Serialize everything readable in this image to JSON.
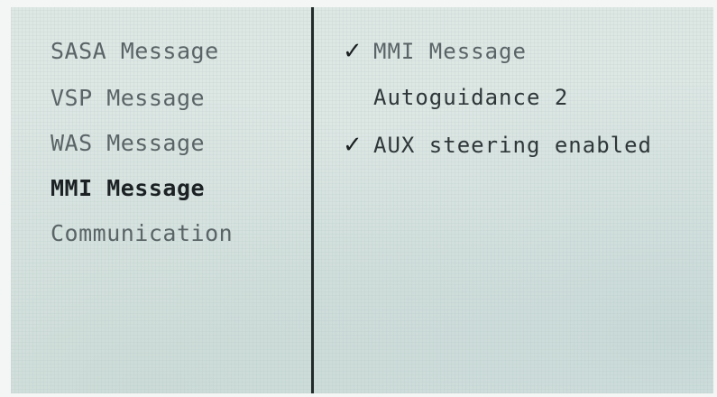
{
  "menu": {
    "items": [
      {
        "label": "SASA Message"
      },
      {
        "label": "VSP Message"
      },
      {
        "label": "WAS Message"
      },
      {
        "label": "MMI Message",
        "selected": true
      },
      {
        "label": "Communication"
      }
    ]
  },
  "options": {
    "items": [
      {
        "label": "MMI Message",
        "checked": true,
        "check_glyph": "✓"
      },
      {
        "label": "Autoguidance 2",
        "checked": false,
        "check_glyph": ""
      },
      {
        "label": "AUX steering enabled",
        "checked": true,
        "check_glyph": "✓"
      }
    ]
  },
  "colors": {
    "screen_bg": "#dde7e4",
    "text_dim": "#5a6466",
    "text_active": "#1c2224",
    "divider": "#222a2a"
  }
}
